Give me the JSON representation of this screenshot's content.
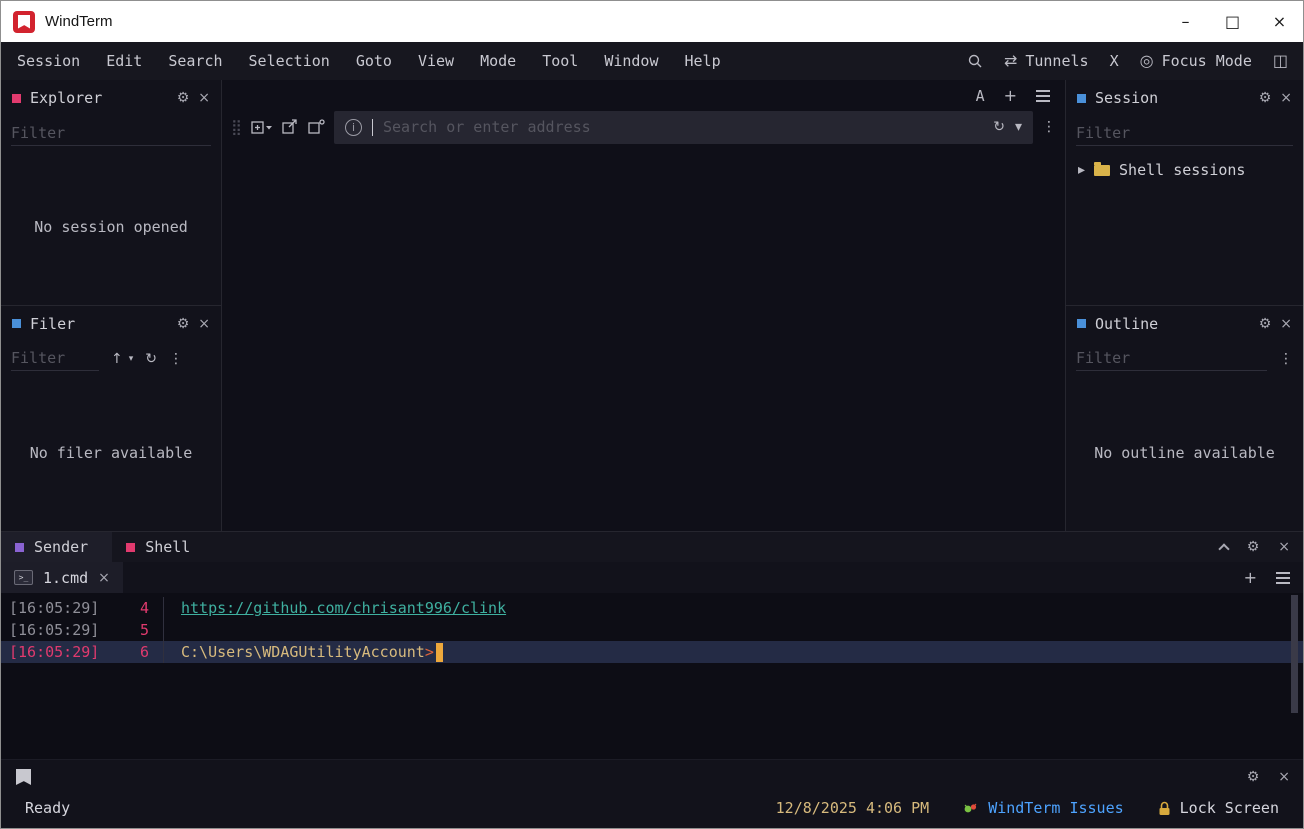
{
  "window": {
    "title": "WindTerm",
    "minimize": "–",
    "maximize": "□",
    "close": "×"
  },
  "menubar": {
    "items": [
      "Session",
      "Edit",
      "Search",
      "Selection",
      "Goto",
      "View",
      "Mode",
      "Tool",
      "Window",
      "Help"
    ],
    "tunnels_label": "Tunnels",
    "x_label": "X",
    "focus_mode_label": "Focus Mode"
  },
  "panels": {
    "explorer": {
      "title": "Explorer",
      "filter_placeholder": "Filter",
      "empty_text": "No session opened"
    },
    "filer": {
      "title": "Filer",
      "filter_placeholder": "Filter",
      "empty_text": "No filer available"
    },
    "session": {
      "title": "Session",
      "filter_placeholder": "Filter",
      "tree_item_label": "Shell sessions"
    },
    "outline": {
      "title": "Outline",
      "filter_placeholder": "Filter",
      "empty_text": "No outline available"
    }
  },
  "main": {
    "address_placeholder": "Search or enter address",
    "font_button_label": "A"
  },
  "bottom": {
    "tabs": [
      {
        "label": "Sender"
      },
      {
        "label": "Shell"
      }
    ],
    "terminal_tab_label": "1.cmd",
    "lines": [
      {
        "timestamp": "[16:05:29]",
        "number": "4",
        "text": "https://github.com/chrisant996/clink"
      },
      {
        "timestamp": "[16:05:29]",
        "number": "5",
        "text": ""
      },
      {
        "timestamp": "[16:05:29]",
        "number": "6",
        "text": "C:\\Users\\WDAGUtilityAccount",
        "prompt_char": ">"
      }
    ]
  },
  "statusbar": {
    "ready_label": "Ready",
    "datetime": "12/8/2025 4:06 PM",
    "issues_label": "WindTerm Issues",
    "lock_label": "Lock Screen"
  },
  "icons": {
    "gear": "⚙",
    "close": "×",
    "plus": "+",
    "dots_vertical": "⋮",
    "chevron_down": "▾",
    "chevron_right": "▸",
    "arrow_up": "↑",
    "refresh": "↻",
    "tunnels": "⇄",
    "focus_mode": "◎",
    "layout": "◫",
    "info": "i",
    "drag_handle": "⣿",
    "terminal_prompt": ">_"
  },
  "colors": {
    "explorer_accent": "#e13a6e",
    "filer_accent": "#4a90d9",
    "session_accent": "#4a90d9",
    "outline_accent": "#4a90d9",
    "sender_accent": "#8a63d2",
    "shell_accent": "#e13a6e",
    "timestamp_highlight": "#e13a6e",
    "link_teal": "#3fb0a0",
    "prompt_yellow": "#d7ba7d",
    "datetime_yellow": "#d7ba7d",
    "issues_blue": "#4da3ff"
  }
}
